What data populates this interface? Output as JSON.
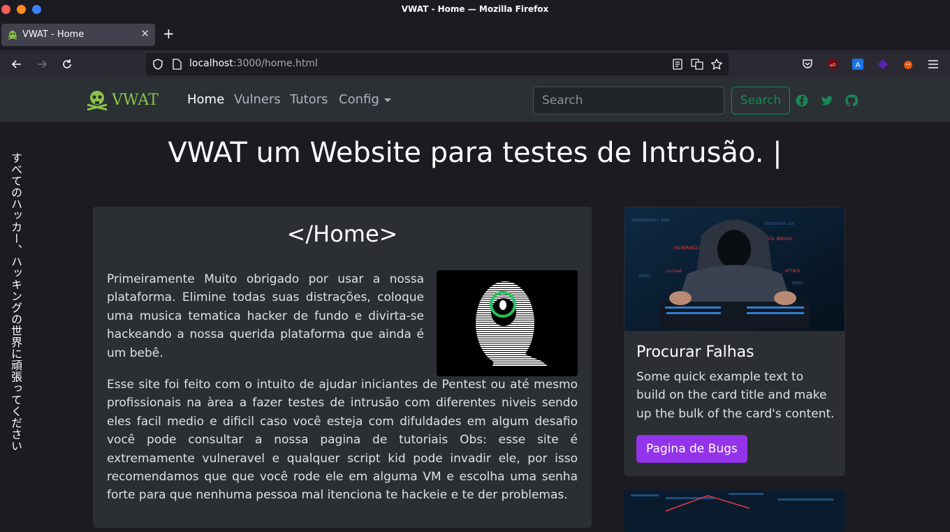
{
  "window": {
    "title": "VWAT - Home — Mozilla Firefox"
  },
  "browser": {
    "tab_title": "VWAT - Home",
    "url_host": "localhost",
    "url_path": ":3000/home.html"
  },
  "site": {
    "brand": "VWAT",
    "nav": {
      "home": "Home",
      "vulners": "Vulners",
      "tutors": "Tutors",
      "config": "Config"
    },
    "search_placeholder": "Search",
    "search_button": "Search",
    "social_icons": [
      "facebook-icon",
      "twitter-icon",
      "github-icon"
    ]
  },
  "page": {
    "vertical_text": "すべてのハッカー、ハッキングの世界に頑張ってください",
    "hero_title": "VWAT um Website para testes de Intrusão. |",
    "main_heading": "</Home>",
    "paragraph1": "Primeiramente Muito obrigado por usar a nossa plataforma. Elimine todas suas distrações, coloque uma musica tematica hacker de fundo e divirta-se hackeando a nossa querida plataforma que ainda é um bebê.",
    "paragraph2": "Esse site foi feito com o intuito de ajudar iniciantes de Pentest ou até mesmo profissionais na àrea a fazer testes de intrusão com diferentes niveis sendo eles facil medio e dificil caso você esteja com difuldades em algum desafio você pode consultar a nossa pagina de tutoriais Obs: esse site é extremamente vulneravel e qualquer script kid pode invadir ele, por isso recomendamos que que você rode ele em alguma VM e escolha uma senha forte para que nenhuma pessoa mal itenciona te hackeie e te der problemas."
  },
  "card": {
    "title": "Procurar Falhas",
    "text": "Some quick example text to build on the card title and make up the bulk of the card's content.",
    "button": "Pagina de Bugs",
    "image_labels": [
      "VULNERABILITY",
      "DATA BREACH",
      "ATTACK",
      "Locked"
    ]
  },
  "colors": {
    "brand_green": "#8bc34a",
    "success": "#198754",
    "button_purple": "#9333ea"
  }
}
